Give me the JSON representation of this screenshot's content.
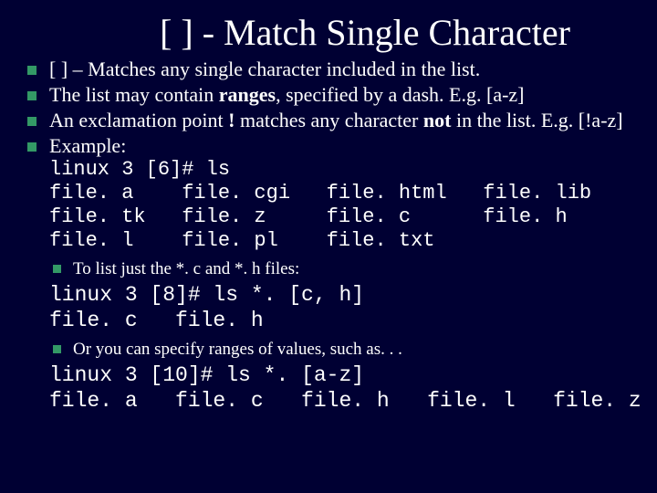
{
  "title": "[ ] - Match Single Character",
  "bullets": {
    "b1": "[ ] – Matches any single character included in the list.",
    "b2_pre": "The list may contain ",
    "b2_bold": "ranges",
    "b2_post": ", specified by a dash.  E.g. [a-z]",
    "b3_pre": "An exclamation point ",
    "b3_bold1": "!",
    "b3_mid": " matches any character ",
    "b3_bold2": "not",
    "b3_post": " in the list.  E.g. [!a-z]",
    "b4": "Example:"
  },
  "code1": "linux 3 [6]# ls\nfile. a    file. cgi   file. html   file. lib\nfile. tk   file. z     file. c      file. h\nfile. l    file. pl    file. txt",
  "sub1": "To list just the *. c and *. h files:",
  "code2": "linux 3 [8]# ls *. [c, h]\nfile. c   file. h",
  "sub2": "Or you can specify ranges of values, such as. . .",
  "code3": "linux 3 [10]# ls *. [a-z]\nfile. a   file. c   file. h   file. l   file. z"
}
